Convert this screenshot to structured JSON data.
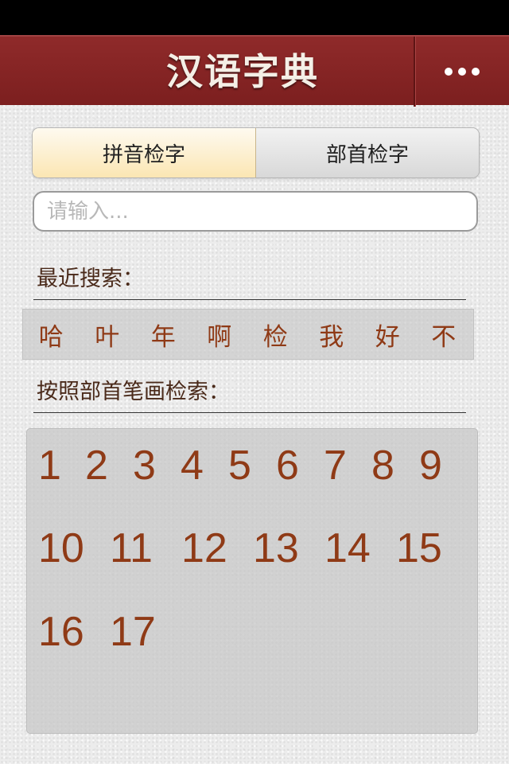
{
  "nav": {
    "title": "汉语字典",
    "more_icon": "ellipsis-icon"
  },
  "segments": [
    {
      "label": "拼音检字",
      "active": true
    },
    {
      "label": "部首检字",
      "active": false
    }
  ],
  "search": {
    "value": "",
    "placeholder": "请输入..."
  },
  "recent": {
    "label": "最近搜索：",
    "chars": [
      "哈",
      "叶",
      "年",
      "啊",
      "检",
      "我",
      "好",
      "不"
    ]
  },
  "strokes": {
    "label": "按照部首笔画检索：",
    "numbers": [
      "1",
      "2",
      "3",
      "4",
      "5",
      "6",
      "7",
      "8",
      "9",
      "10",
      "11",
      "12",
      "13",
      "14",
      "15",
      "16",
      "17"
    ]
  },
  "colors": {
    "nav_bg": "#8b2525",
    "accent_text": "#8f3a16",
    "active_segment": "#fbe6b3"
  }
}
